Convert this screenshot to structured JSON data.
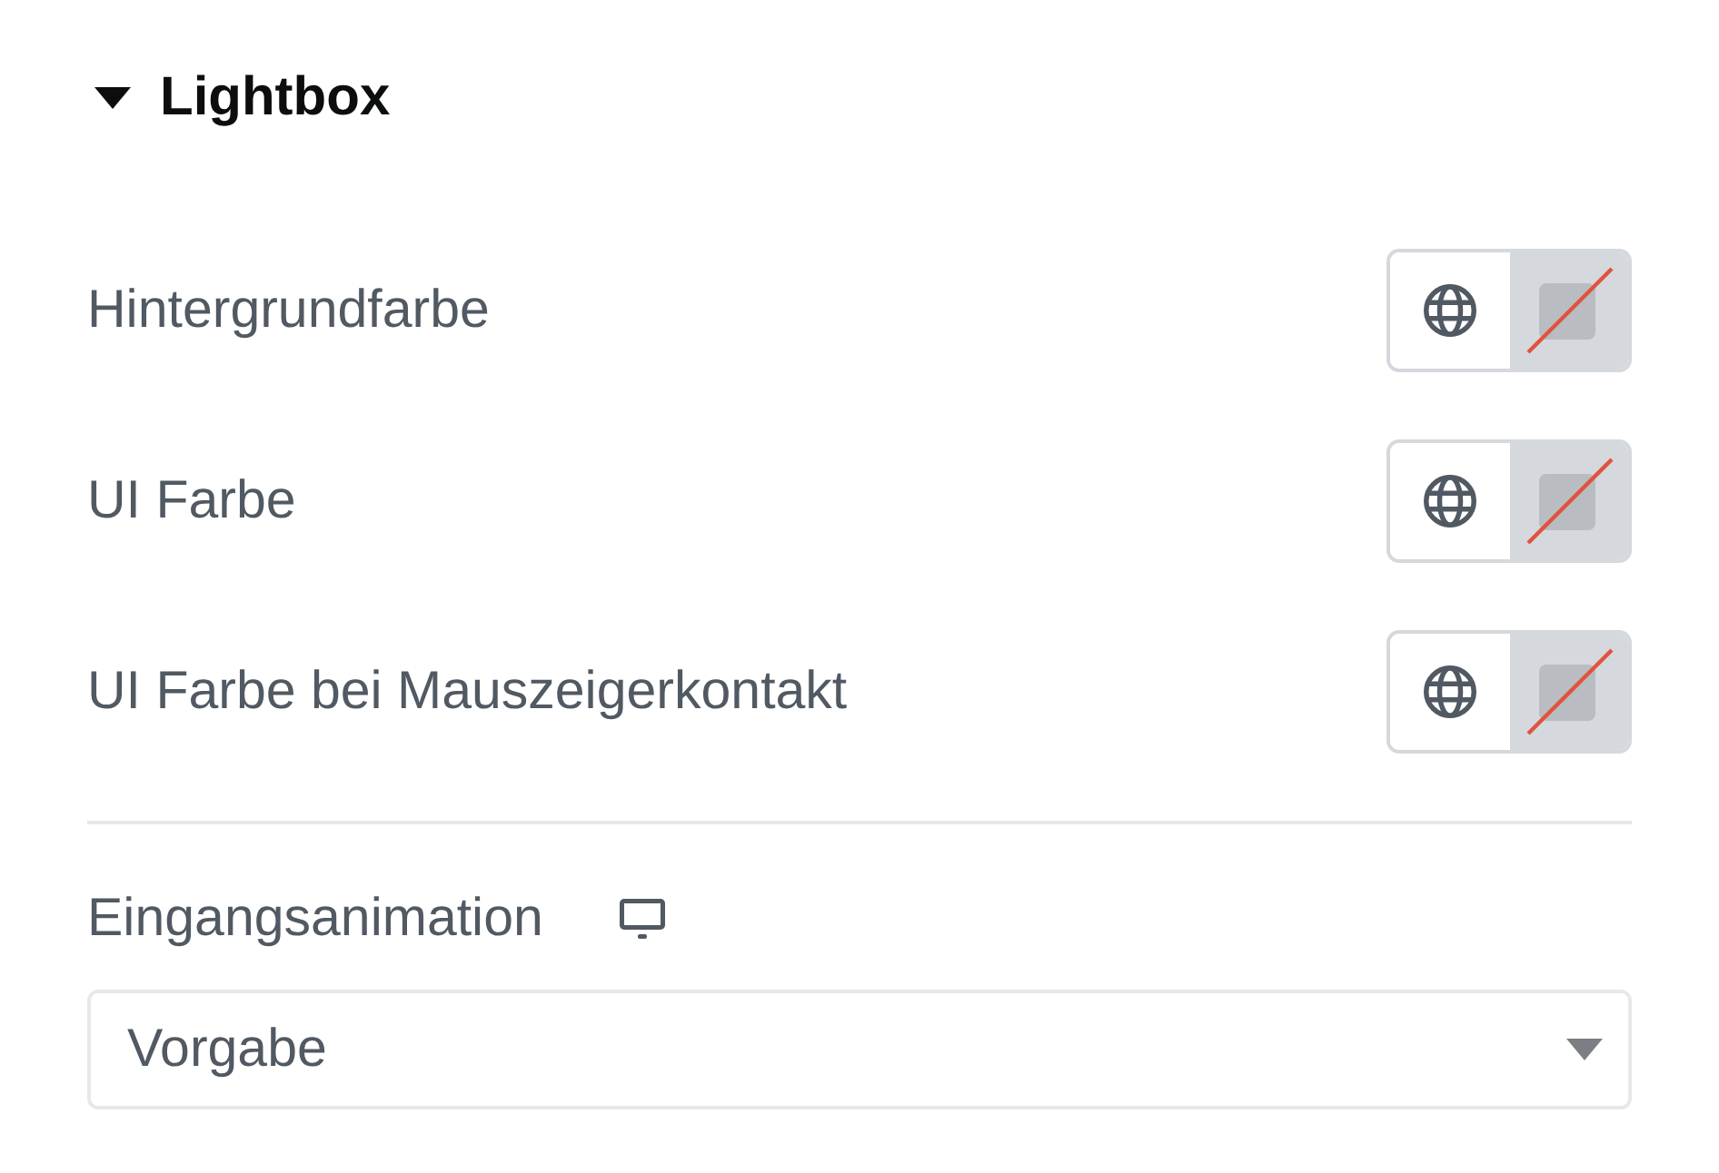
{
  "section": {
    "title": "Lightbox",
    "expanded": true
  },
  "color_controls": [
    {
      "label": "Hintergrundfarbe"
    },
    {
      "label": "UI Farbe"
    },
    {
      "label": "UI Farbe bei Mauszeigerkontakt"
    }
  ],
  "entrance_animation": {
    "label": "Eingangsanimation",
    "select": {
      "value": "Vorgabe"
    }
  }
}
